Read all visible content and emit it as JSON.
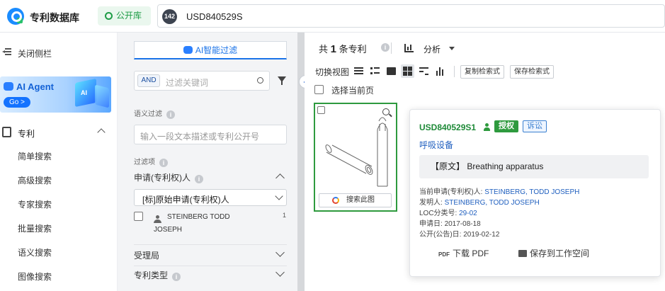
{
  "header": {
    "app_title": "专利数据库",
    "db_label": "公开库",
    "search_count": "142",
    "search_value": "USD840529S"
  },
  "sidebar": {
    "close_label": "关闭侧栏",
    "banner": {
      "title": "AI Agent",
      "go_label": "Go >",
      "cube_label": "AI"
    },
    "section_label": "专利",
    "items": [
      "简单搜索",
      "高级搜索",
      "专家搜索",
      "批量搜索",
      "语义搜索",
      "图像搜索"
    ]
  },
  "filter": {
    "ai_filter_label": "AI智能过滤",
    "and_label": "AND",
    "keyword_placeholder": "过滤关键词",
    "semantic_label": "语义过滤",
    "semantic_placeholder": "输入一段文本描述或专利公开号",
    "filter_items_label": "过滤项",
    "groups": {
      "applicant": "申请(专利权)人",
      "office": "受理局",
      "type": "专利类型"
    },
    "applicant_select": "[标]原始申请(专利权)人",
    "applicant_value_line1": "STEINBERG TODD",
    "applicant_value_line2": "JOSEPH",
    "applicant_count": "1",
    "info_glyph": "i"
  },
  "results": {
    "count_prefix": "共",
    "count": "1",
    "count_suffix": "条专利",
    "analyze_label": "分析",
    "view_label": "切换视图",
    "copy_query": "复制检索式",
    "save_query": "保存检索式",
    "select_page": "选择当前页",
    "search_image": "搜索此图"
  },
  "card": {
    "pub_no": "USD840529S1",
    "status_badge": "授权",
    "lit_badge": "诉讼",
    "title_cn": "呼吸设备",
    "abstract_prefix": "【原文】",
    "abstract_text": "Breathing apparatus",
    "meta": [
      {
        "label": "当前申请(专利权)人:",
        "value": "STEINBERG, TODD JOSEPH",
        "link": true
      },
      {
        "label": "发明人:",
        "value": "STEINBERG, TODD JOSEPH",
        "link": true
      },
      {
        "label": "LOC分类号:",
        "value": "29-02",
        "link": true
      },
      {
        "label": "申请日:",
        "value": "2017-08-18",
        "link": false
      },
      {
        "label": "公开(公告)日:",
        "value": "2019-02-12",
        "link": false
      }
    ],
    "pdf_icon_text": "PDF",
    "download_pdf": "下载 PDF",
    "save_workspace": "保存到工作空间"
  },
  "colors": {
    "accent_blue": "#1a73e8",
    "grant_green": "#2e9a3e",
    "link_blue": "#1f5fbf"
  }
}
